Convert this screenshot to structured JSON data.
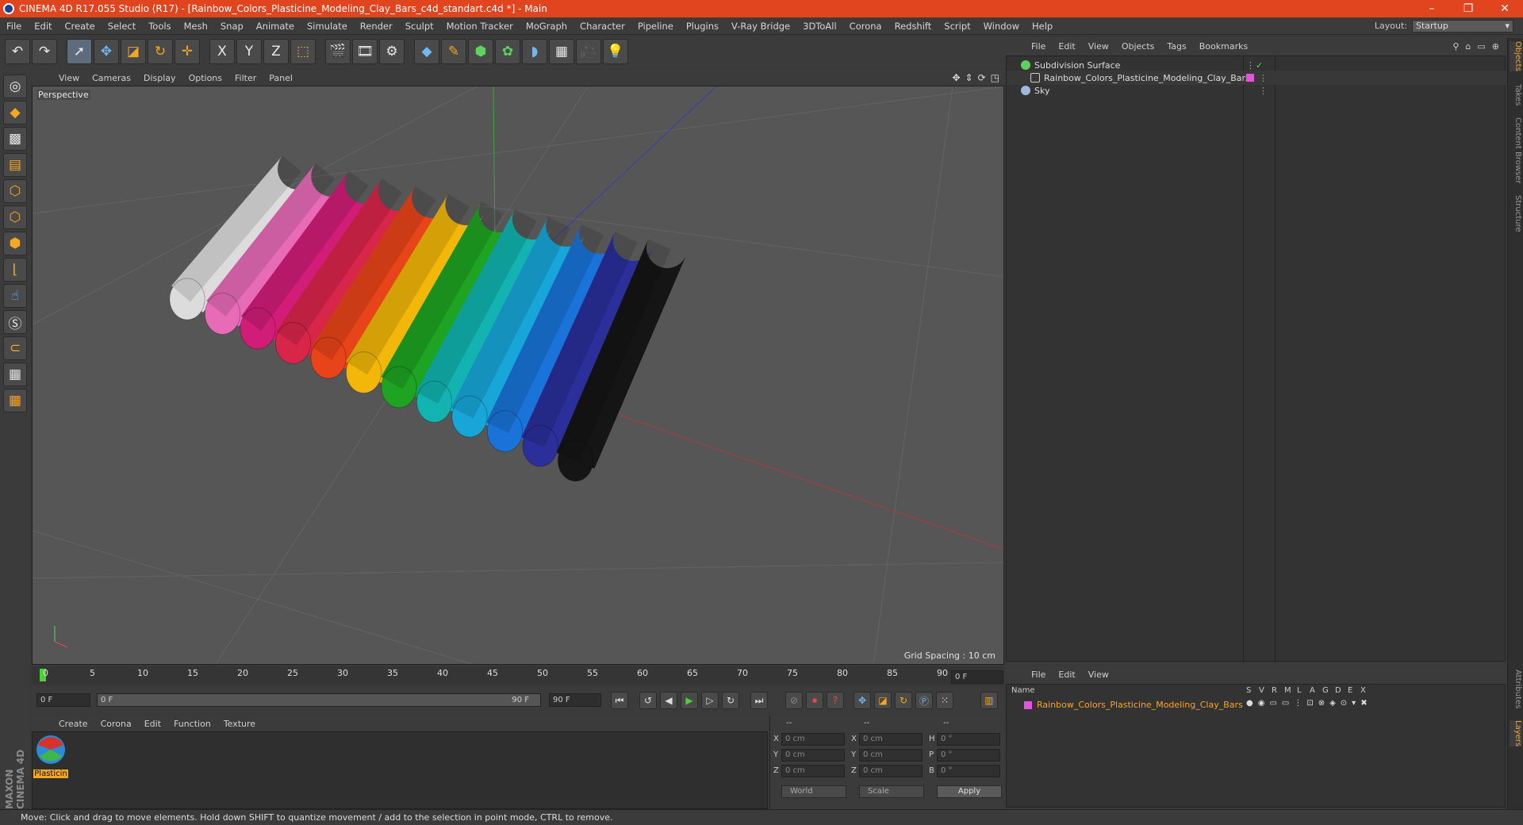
{
  "window": {
    "title": "CINEMA 4D R17.055 Studio (R17) - [Rainbow_Colors_Plasticine_Modeling_Clay_Bars_c4d_standart.c4d *] - Main",
    "buttons": {
      "minimize": "–",
      "restore": "❐",
      "close": "✕"
    }
  },
  "menubar": {
    "items": [
      "File",
      "Edit",
      "Create",
      "Select",
      "Tools",
      "Mesh",
      "Snap",
      "Animate",
      "Simulate",
      "Render",
      "Sculpt",
      "Motion Tracker",
      "MoGraph",
      "Character",
      "Pipeline",
      "Plugins",
      "V-Ray Bridge",
      "3DToAll",
      "Corona",
      "Redshift",
      "Script",
      "Window",
      "Help"
    ],
    "layout_label": "Layout:",
    "layout_value": "Startup"
  },
  "toolbar": {
    "icons": [
      "undo-icon",
      "redo-icon",
      "select-icon",
      "move-icon",
      "scale-icon",
      "rotate-icon",
      "live-select-icon",
      "x-axis-icon",
      "y-axis-icon",
      "z-axis-icon",
      "coordinate-system-icon",
      "render-view-icon",
      "render-picture-viewer-icon",
      "edit-render-settings-icon",
      "cube-icon",
      "pen-icon",
      "subdivision-icon",
      "cloner-icon",
      "deformer-icon",
      "floor-icon",
      "camera-icon",
      "light-icon"
    ],
    "axis_labels": [
      "X",
      "Y",
      "Z"
    ]
  },
  "viewport": {
    "menu": [
      "View",
      "Cameras",
      "Display",
      "Options",
      "Filter",
      "Panel"
    ],
    "label": "Perspective",
    "grid_spacing": "Grid Spacing : 10 cm",
    "clay_bar_colors": [
      "#dcdcdc",
      "#e86bb8",
      "#d11d78",
      "#d8254a",
      "#e8441a",
      "#f2b708",
      "#1ea322",
      "#12b3b0",
      "#18a6d8",
      "#1a73d8",
      "#2a2f9a",
      "#151515"
    ]
  },
  "timeline": {
    "ticks": [
      "0",
      "5",
      "10",
      "15",
      "20",
      "25",
      "30",
      "35",
      "40",
      "45",
      "50",
      "55",
      "60",
      "65",
      "70",
      "75",
      "80",
      "85",
      "90"
    ],
    "current_frame": "0 F"
  },
  "transport": {
    "start_field": "0 F",
    "range_start": "0 F",
    "range_end": "90 F",
    "end_field": "90 F"
  },
  "material_manager": {
    "menu": [
      "Create",
      "Corona",
      "Edit",
      "Function",
      "Texture"
    ],
    "materials": [
      {
        "name": "Plasticin"
      }
    ]
  },
  "coordinates": {
    "headers": [
      "--",
      "--",
      "--"
    ],
    "rows": [
      {
        "pos_label": "X",
        "pos": "0 cm",
        "size_label": "X",
        "size": "0 cm",
        "rot_label": "H",
        "rot": "0 °"
      },
      {
        "pos_label": "Y",
        "pos": "0 cm",
        "size_label": "Y",
        "size": "0 cm",
        "rot_label": "P",
        "rot": "0 °"
      },
      {
        "pos_label": "Z",
        "pos": "0 cm",
        "size_label": "Z",
        "size": "0 cm",
        "rot_label": "B",
        "rot": "0 °"
      }
    ],
    "world_dropdown": "World",
    "scale_dropdown": "Scale",
    "apply_label": "Apply"
  },
  "object_manager": {
    "menu": [
      "File",
      "Edit",
      "View",
      "Objects",
      "Tags",
      "Bookmarks"
    ],
    "objects": [
      {
        "name": "Subdivision Surface",
        "icon": "subdivision-surface-icon",
        "color": "#5ed15e"
      },
      {
        "name": "Rainbow_Colors_Plasticine_Modeling_Clay_Bars",
        "icon": "null-object-icon",
        "color": "#c8c8c8",
        "tag_color": "#e055e0"
      },
      {
        "name": "Sky",
        "icon": "sky-icon",
        "color": "#9fb8d8"
      }
    ]
  },
  "layer_manager": {
    "menu": [
      "File",
      "Edit",
      "View"
    ],
    "columns": [
      "Name",
      "S",
      "V",
      "R",
      "M",
      "L",
      "A",
      "G",
      "D",
      "E",
      "X"
    ],
    "layers": [
      {
        "name": "Rainbow_Colors_Plasticine_Modeling_Clay_Bars",
        "color": "#e055e0"
      }
    ]
  },
  "right_tabs": [
    "Objects",
    "Takes",
    "Content Browser",
    "Structure"
  ],
  "right_tabs_lower": [
    "Attributes",
    "Layers"
  ],
  "brand": "MAXON CINEMA 4D",
  "status": "Move: Click and drag to move elements. Hold down SHIFT to quantize movement / add to the selection in point mode, CTRL to remove."
}
